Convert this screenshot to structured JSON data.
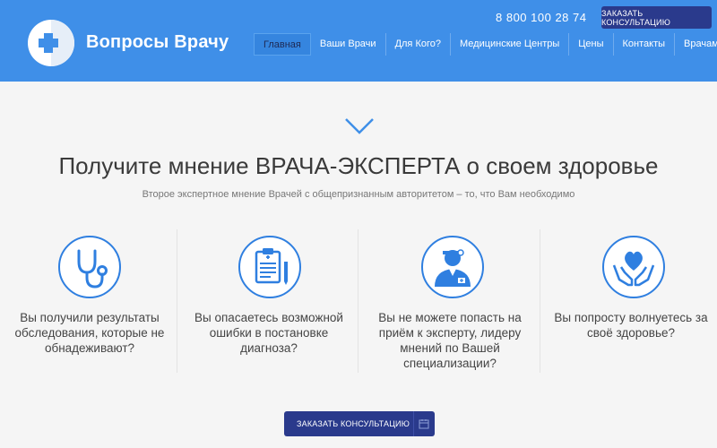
{
  "header": {
    "brand": "Вопросы Врачу",
    "phone": "8 800 100 28 74",
    "cta_label": "ЗАКАЗАТЬ КОНСУЛЬТАЦИЮ",
    "nav": [
      {
        "label": "Главная"
      },
      {
        "label": "Ваши Врачи"
      },
      {
        "label": "Для Кого?"
      },
      {
        "label": "Медицинские Центры"
      },
      {
        "label": "Цены"
      },
      {
        "label": "Контакты"
      },
      {
        "label": "Врачам"
      }
    ]
  },
  "hero": {
    "headline": "Получите мнение ВРАЧА-ЭКСПЕРТА о своем здоровье",
    "subline": "Второе экспертное мнение Врачей с общепризнанным авторитетом – то, что Вам необходимо"
  },
  "features": [
    {
      "icon": "stethoscope-icon",
      "text": "Вы получили результаты обследования, которые не обнадеживают?"
    },
    {
      "icon": "clipboard-icon",
      "text": "Вы опасаетесь возможной ошибки в постановке диагноза?"
    },
    {
      "icon": "doctor-icon",
      "text": "Вы не можете попасть на приём к эксперту, лидеру мнений по Вашей специализации?"
    },
    {
      "icon": "heart-hands-icon",
      "text": "Вы попросту волнуетесь за своё здоровье?"
    }
  ],
  "bottom_cta": {
    "label": "ЗАКАЗАТЬ КОНСУЛЬТАЦИЮ"
  },
  "colors": {
    "header_bg": "#3f8fe8",
    "button_bg": "#2a3a8c",
    "icon_blue": "#2f7fe0"
  }
}
